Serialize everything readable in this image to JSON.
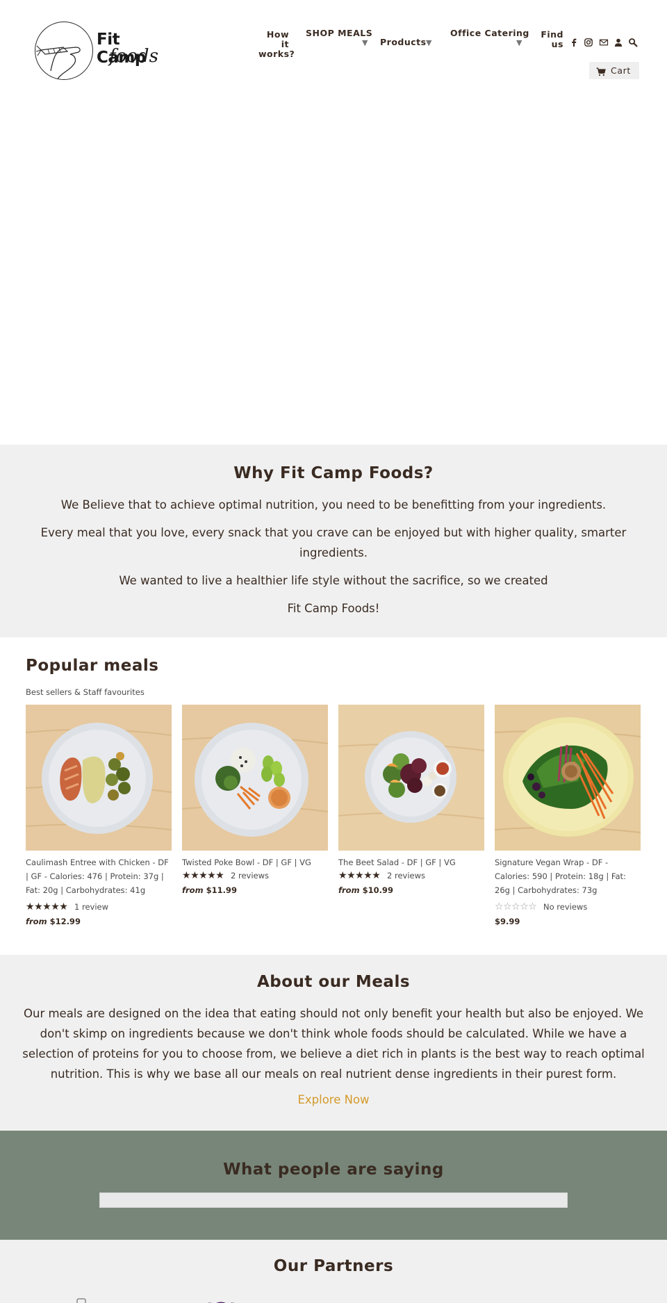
{
  "header": {
    "logo_line1": "Fit Camp",
    "logo_line2": "foods",
    "nav": {
      "how_it_works_1": "How it",
      "how_it_works_2": "works?",
      "shop_meals": "SHOP MEALS",
      "products": "Products",
      "office_catering": "Office Catering",
      "find_us_1": "Find",
      "find_us_2": "us"
    },
    "caret": "▼",
    "cart_label": "Cart"
  },
  "why": {
    "title": "Why Fit Camp Foods?",
    "p1": "We Believe that to achieve optimal nutrition, you need to be benefitting from your ingredients.",
    "p2": "Every meal that you love, every snack that you crave can be enjoyed but with higher quality, smarter ingredients.",
    "p3": "We wanted to live a healthier life style without the sacrifice, so we created",
    "p4": "Fit Camp Foods!"
  },
  "popular": {
    "title": "Popular meals",
    "subtitle": "Best sellers & Staff favourites",
    "products": [
      {
        "title": "Caulimash Entree with Chicken - DF | GF - Calories: 476 | Protein: 37g | Fat: 20g | Carbohydrates: 41g",
        "rating": 5,
        "reviews": "1 review",
        "price_prefix": "from",
        "price": "$12.99"
      },
      {
        "title": "Twisted Poke Bowl - DF | GF | VG",
        "rating": 5,
        "reviews": "2 reviews",
        "price_prefix": "from",
        "price": "$11.99"
      },
      {
        "title": "The Beet Salad - DF | GF | VG",
        "rating": 5,
        "reviews": "2 reviews",
        "price_prefix": "from",
        "price": "$10.99"
      },
      {
        "title": "Signature Vegan Wrap - DF - Calories: 590 | Protein: 18g | Fat: 26g | Carbohydrates: 73g",
        "rating": 0,
        "reviews": "No reviews",
        "price_prefix": "",
        "price": "$9.99"
      }
    ]
  },
  "about": {
    "title": "About our Meals",
    "body": "Our meals are designed on the idea that eating should not only benefit your health but also be enjoyed. We don't skimp on ingredients because we don't think whole foods should be calculated. While we have a selection of proteins for you to choose from, we believe a diet rich in plants is the best way to reach optimal nutrition. This is why we base all our meals on real nutrient dense ingredients in their purest form.",
    "cta": "Explore Now"
  },
  "testimonials": {
    "title": "What people are saying"
  },
  "partners": {
    "title": "Our Partners"
  },
  "colors": {
    "text": "#3a2b22",
    "section_gray": "#f0f0f0",
    "testimonials_bg": "#778678",
    "accent_link": "#d49a2a"
  },
  "icons": [
    "facebook-icon",
    "instagram-icon",
    "mail-icon",
    "account-icon",
    "search-icon",
    "cart-icon",
    "star-icon"
  ]
}
